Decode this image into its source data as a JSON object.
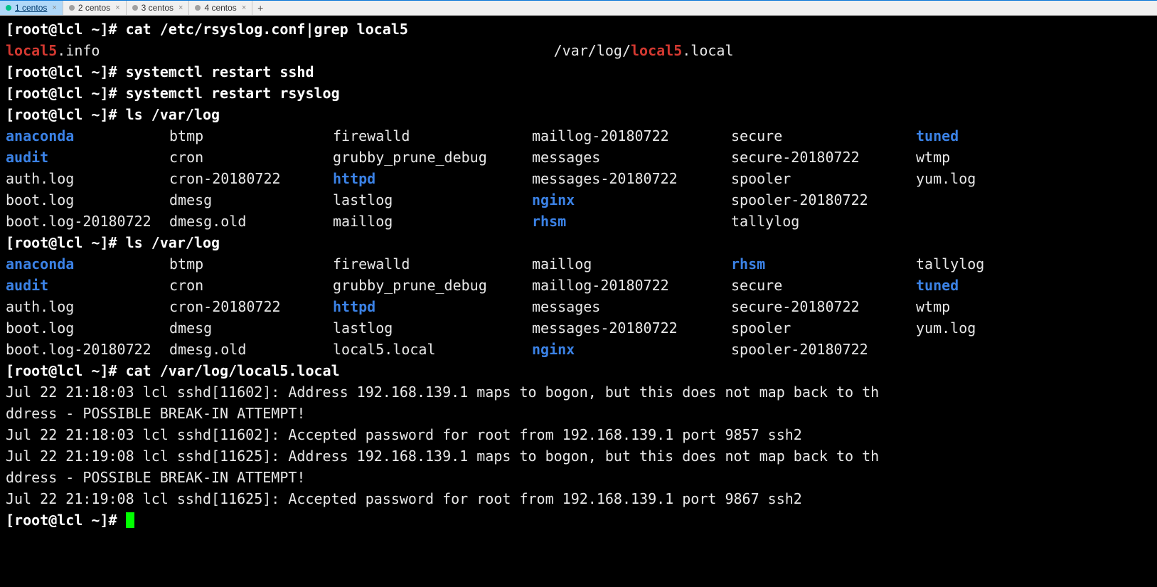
{
  "tabs": [
    {
      "label": "1 centos",
      "color": "#00c389",
      "active": true,
      "underline": true
    },
    {
      "label": "2 centos",
      "color": "#a0a0a0",
      "active": false,
      "underline": false
    },
    {
      "label": "3 centos",
      "color": "#a0a0a0",
      "active": false,
      "underline": false
    },
    {
      "label": "4 centos",
      "color": "#a0a0a0",
      "active": false,
      "underline": false
    }
  ],
  "prompt": "[root@lcl ~]# ",
  "cmds": {
    "c1": "cat /etc/rsyslog.conf|grep local5",
    "c2": "systemctl restart sshd",
    "c3": "systemctl restart rsyslog",
    "c4": "ls /var/log",
    "c5": "ls /var/log",
    "c6": "cat /var/log/local5.local"
  },
  "grep_line": {
    "pre": "local5",
    "mid": ".info",
    "gap": "                                                     /var/log/",
    "hit": "local5",
    "post": ".local"
  },
  "ls1": [
    [
      {
        "t": "anaconda",
        "c": "blue"
      },
      {
        "t": "btmp"
      },
      {
        "t": "firewalld"
      },
      {
        "t": "maillog-20180722"
      },
      {
        "t": "secure"
      },
      {
        "t": "tuned",
        "c": "blue"
      }
    ],
    [
      {
        "t": "audit",
        "c": "blue"
      },
      {
        "t": "cron"
      },
      {
        "t": "grubby_prune_debug"
      },
      {
        "t": "messages"
      },
      {
        "t": "secure-20180722"
      },
      {
        "t": "wtmp"
      }
    ],
    [
      {
        "t": "auth.log"
      },
      {
        "t": "cron-20180722"
      },
      {
        "t": "httpd",
        "c": "blue"
      },
      {
        "t": "messages-20180722"
      },
      {
        "t": "spooler"
      },
      {
        "t": "yum.log"
      }
    ],
    [
      {
        "t": "boot.log"
      },
      {
        "t": "dmesg"
      },
      {
        "t": "lastlog"
      },
      {
        "t": "nginx",
        "c": "blue"
      },
      {
        "t": "spooler-20180722"
      },
      {
        "t": ""
      }
    ],
    [
      {
        "t": "boot.log-20180722"
      },
      {
        "t": "dmesg.old"
      },
      {
        "t": "maillog"
      },
      {
        "t": "rhsm",
        "c": "blue"
      },
      {
        "t": "tallylog"
      },
      {
        "t": ""
      }
    ]
  ],
  "ls2": [
    [
      {
        "t": "anaconda",
        "c": "blue"
      },
      {
        "t": "btmp"
      },
      {
        "t": "firewalld"
      },
      {
        "t": "maillog"
      },
      {
        "t": "rhsm",
        "c": "blue"
      },
      {
        "t": "tallylog"
      }
    ],
    [
      {
        "t": "audit",
        "c": "blue"
      },
      {
        "t": "cron"
      },
      {
        "t": "grubby_prune_debug"
      },
      {
        "t": "maillog-20180722"
      },
      {
        "t": "secure"
      },
      {
        "t": "tuned",
        "c": "blue"
      }
    ],
    [
      {
        "t": "auth.log"
      },
      {
        "t": "cron-20180722"
      },
      {
        "t": "httpd",
        "c": "blue"
      },
      {
        "t": "messages"
      },
      {
        "t": "secure-20180722"
      },
      {
        "t": "wtmp"
      }
    ],
    [
      {
        "t": "boot.log"
      },
      {
        "t": "dmesg"
      },
      {
        "t": "lastlog"
      },
      {
        "t": "messages-20180722"
      },
      {
        "t": "spooler"
      },
      {
        "t": "yum.log"
      }
    ],
    [
      {
        "t": "boot.log-20180722"
      },
      {
        "t": "dmesg.old"
      },
      {
        "t": "local5.local"
      },
      {
        "t": "nginx",
        "c": "blue"
      },
      {
        "t": "spooler-20180722"
      },
      {
        "t": ""
      }
    ]
  ],
  "loglines": [
    "Jul 22 21:18:03 lcl sshd[11602]: Address 192.168.139.1 maps to bogon, but this does not map back to th",
    "ddress - POSSIBLE BREAK-IN ATTEMPT!",
    "Jul 22 21:18:03 lcl sshd[11602]: Accepted password for root from 192.168.139.1 port 9857 ssh2",
    "Jul 22 21:19:08 lcl sshd[11625]: Address 192.168.139.1 maps to bogon, but this does not map back to th",
    "ddress - POSSIBLE BREAK-IN ATTEMPT!",
    "Jul 22 21:19:08 lcl sshd[11625]: Accepted password for root from 192.168.139.1 port 9867 ssh2"
  ]
}
